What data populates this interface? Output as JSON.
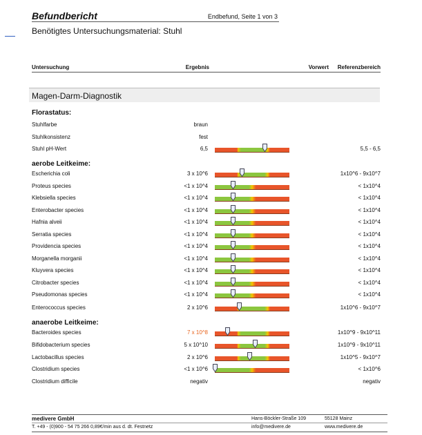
{
  "header": {
    "title": "Befundbericht",
    "page_info": "Endbefund, Seite 1 von 3",
    "material": "Benötigtes Untersuchungsmaterial: Stuhl"
  },
  "columns": {
    "test": "Untersuchung",
    "result": "Ergebnis",
    "previous": "Vorwert",
    "reference": "Referenzbereich"
  },
  "section": {
    "title": "Magen-Darm-Diagnostik"
  },
  "groups": [
    {
      "title": "Florastatus:",
      "rows": [
        {
          "label": "Stuhlfarbe",
          "result": "braun",
          "reference": ""
        },
        {
          "label": "Stuhlkonsistenz",
          "result": "fest",
          "reference": ""
        },
        {
          "label": "Stuhl pH-Wert",
          "result": "6,5",
          "reference": "5,5 - 6,5",
          "bar": {
            "type": "mid",
            "marker": 0.67
          }
        }
      ]
    },
    {
      "title": "aerobe Leitkeime:",
      "rows": [
        {
          "label": "Escherichia coli",
          "result": "3 x 10^6",
          "reference": "1x10^6 - 9x10^7",
          "bar": {
            "type": "mid",
            "marker": 0.36
          }
        },
        {
          "label": "Proteus species",
          "result": "<1 x 10^4",
          "reference": "< 1x10^4",
          "bar": {
            "type": "low",
            "marker": 0.24
          }
        },
        {
          "label": "Klebsiella species",
          "result": "<1 x 10^4",
          "reference": "< 1x10^4",
          "bar": {
            "type": "low",
            "marker": 0.24
          }
        },
        {
          "label": "Enterobacter species",
          "result": "<1 x 10^4",
          "reference": "< 1x10^4",
          "bar": {
            "type": "low",
            "marker": 0.24
          }
        },
        {
          "label": "Hafnia alveii",
          "result": "<1 x 10^4",
          "reference": "< 1x10^4",
          "bar": {
            "type": "low",
            "marker": 0.24
          }
        },
        {
          "label": "Serratia species",
          "result": "<1 x 10^4",
          "reference": "< 1x10^4",
          "bar": {
            "type": "low",
            "marker": 0.24
          }
        },
        {
          "label": "Providencia species",
          "result": "<1 x 10^4",
          "reference": "< 1x10^4",
          "bar": {
            "type": "low",
            "marker": 0.24
          }
        },
        {
          "label": "Morganella morganii",
          "result": "<1 x 10^4",
          "reference": "< 1x10^4",
          "bar": {
            "type": "low",
            "marker": 0.24
          }
        },
        {
          "label": "Kluyvera species",
          "result": "<1 x 10^4",
          "reference": "< 1x10^4",
          "bar": {
            "type": "low",
            "marker": 0.24
          }
        },
        {
          "label": "Citrobacter species",
          "result": "<1 x 10^4",
          "reference": "< 1x10^4",
          "bar": {
            "type": "low",
            "marker": 0.24
          }
        },
        {
          "label": "Pseudomonas species",
          "result": "<1 x 10^4",
          "reference": "< 1x10^4",
          "bar": {
            "type": "low",
            "marker": 0.24
          }
        },
        {
          "label": "Enterococcus species",
          "result": "2 x 10^6",
          "reference": "1x10^6 - 9x10^7",
          "bar": {
            "type": "mid",
            "marker": 0.32
          }
        }
      ]
    },
    {
      "title": "anaerobe Leitkeime:",
      "rows": [
        {
          "label": "Bacteroides species",
          "result": "7 x 10^8",
          "flag": true,
          "reference": "1x10^9 - 9x10^11",
          "bar": {
            "type": "mid",
            "marker": 0.17
          }
        },
        {
          "label": "Bifidobacterium species",
          "result": "5 x 10^10",
          "reference": "1x10^9 - 9x10^11",
          "bar": {
            "type": "mid",
            "marker": 0.54
          }
        },
        {
          "label": "Lactobacillus species",
          "result": "2 x 10^6",
          "reference": "1x10^5 - 9x10^7",
          "bar": {
            "type": "mid",
            "marker": 0.46
          }
        },
        {
          "label": "Clostridium species",
          "result": "<1 x 10^6",
          "reference": "< 1x10^6",
          "bar": {
            "type": "low",
            "marker": 0.0
          }
        },
        {
          "label": "Clostridium difficile",
          "result": "negativ",
          "reference": "negativ"
        }
      ]
    }
  ],
  "footer": {
    "company": "medivere GmbH",
    "street": "Hans-Böckler-Straße 109",
    "city": "55128 Mainz",
    "phone": "T. +49 - (0)900 - 54 75 266   0,89€/min aus d. dt. Festnetz",
    "email": "info@medivere.de",
    "web": "www.medivere.de"
  },
  "colors": {
    "bar_green": "#8cc63f",
    "bar_red": "#e8552a",
    "bar_yellow": "#f5c400",
    "flag_orange": "#e8641e"
  }
}
